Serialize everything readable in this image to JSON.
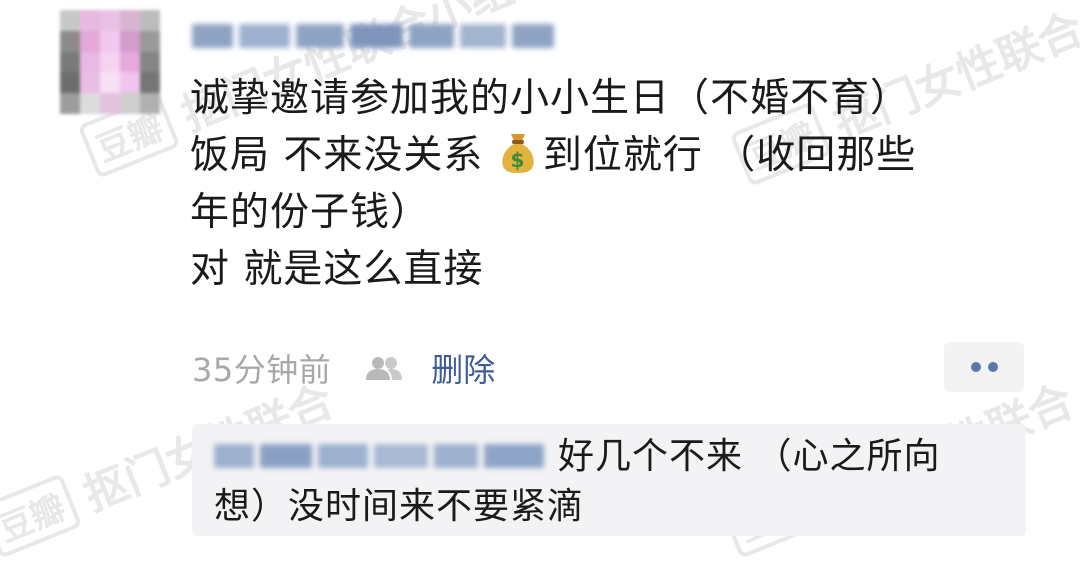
{
  "comment": {
    "lines": [
      "诚挚邀请参加我的小小生日（不婚不育）",
      "饭局 不来没关系",
      "到位就行 （收回那些",
      "年的份子钱）",
      "对 就是这么直接"
    ],
    "emoji_icon": "money-bag-icon",
    "time": "35分钟前",
    "friends_icon": "two-people-icon",
    "delete_label": "删除",
    "more_icon": "more-dots-icon"
  },
  "reply": {
    "line1": "好几个不来 （心之所向",
    "line2": "想）没时间来不要紧滴"
  },
  "watermarks": [
    {
      "logo": "豆瓣",
      "text": "抠门女性联合小组"
    },
    {
      "logo": "豆瓣",
      "text": "抠门女性联合"
    },
    {
      "logo": "豆瓣",
      "text": "抠门女性联合"
    },
    {
      "logo": "豆瓣",
      "text": "抠门女性联合"
    }
  ],
  "colors": {
    "link": "#3d5e94",
    "meta_text": "#a8a8a8",
    "reply_bg": "#f3f3f5",
    "dots": "#5b78a9"
  }
}
